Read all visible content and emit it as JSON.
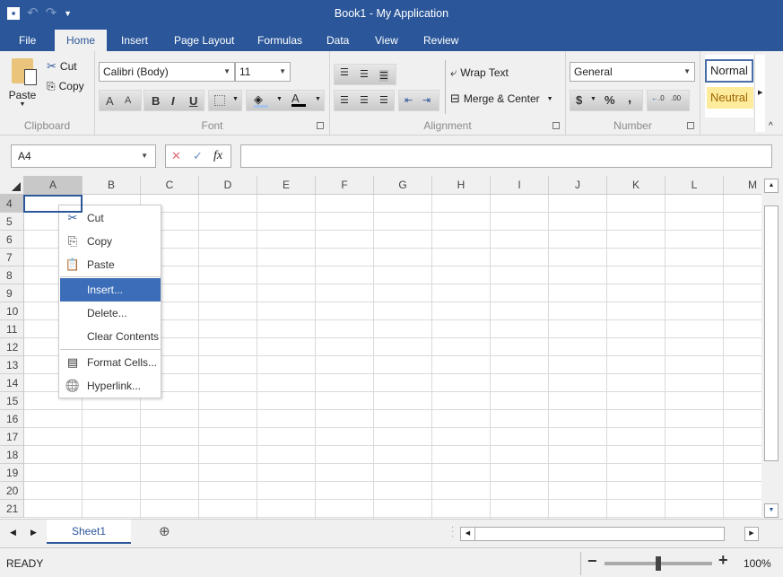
{
  "window": {
    "title": "Book1 - My Application"
  },
  "qat": {
    "save_icon": "💾",
    "undo_icon": "↶",
    "redo_icon": "↷",
    "customize_icon": "▼"
  },
  "tabs": [
    {
      "label": "File"
    },
    {
      "label": "Home"
    },
    {
      "label": "Insert"
    },
    {
      "label": "Page Layout"
    },
    {
      "label": "Formulas"
    },
    {
      "label": "Data"
    },
    {
      "label": "View"
    },
    {
      "label": "Review"
    }
  ],
  "active_tab": "Home",
  "ribbon": {
    "clipboard": {
      "label": "Clipboard",
      "paste": "Paste",
      "cut": "Cut",
      "copy": "Copy"
    },
    "font": {
      "label": "Font",
      "font_name": "Calibri (Body)",
      "font_size": "11",
      "bold": "B",
      "italic": "I",
      "underline": "U",
      "font_color": "A",
      "increase": "A",
      "decrease": "A"
    },
    "alignment": {
      "label": "Alignment",
      "wrap_text": "Wrap Text",
      "merge_center": "Merge & Center"
    },
    "number": {
      "label": "Number",
      "format": "General",
      "currency": "$",
      "percent": "%",
      "comma": ",",
      "inc_decimal": ".00",
      "dec_decimal": ".0"
    },
    "styles": {
      "normal": "Normal",
      "neutral": "Neutral"
    }
  },
  "formula_bar": {
    "name_box": "A4",
    "cancel_icon": "✕",
    "enter_icon": "✓",
    "fx": "fx",
    "value": ""
  },
  "grid": {
    "columns": [
      "A",
      "B",
      "C",
      "D",
      "E",
      "F",
      "G",
      "H",
      "I",
      "J",
      "K",
      "L",
      "M"
    ],
    "rows": [
      "4",
      "5",
      "6",
      "7",
      "8",
      "9",
      "10",
      "11",
      "12",
      "13",
      "14",
      "15",
      "16",
      "17",
      "18",
      "19",
      "20",
      "21"
    ],
    "selected_cell": "A4"
  },
  "context_menu": {
    "items": [
      {
        "label": "Cut",
        "icon": "cut-icon"
      },
      {
        "label": "Copy",
        "icon": "copy-icon"
      },
      {
        "label": "Paste",
        "icon": "paste-icon"
      },
      {
        "label": "Insert...",
        "icon": ""
      },
      {
        "label": "Delete...",
        "icon": ""
      },
      {
        "label": "Clear Contents",
        "icon": ""
      },
      {
        "label": "Format Cells...",
        "icon": "format-cells-icon"
      },
      {
        "label": "Hyperlink...",
        "icon": "hyperlink-icon"
      }
    ],
    "highlighted": "Insert..."
  },
  "sheets": {
    "tabs": [
      {
        "label": "Sheet1"
      }
    ],
    "add_icon": "⊕"
  },
  "status": {
    "text": "READY",
    "zoom": "100%",
    "zoom_minus": "−",
    "zoom_plus": "+",
    "zoom_level_percent": 100
  },
  "colors": {
    "accent": "#2b579a",
    "highlight": "#3b6db8",
    "neutral_bg": "#ffeb9c",
    "neutral_fg": "#9c6500"
  }
}
